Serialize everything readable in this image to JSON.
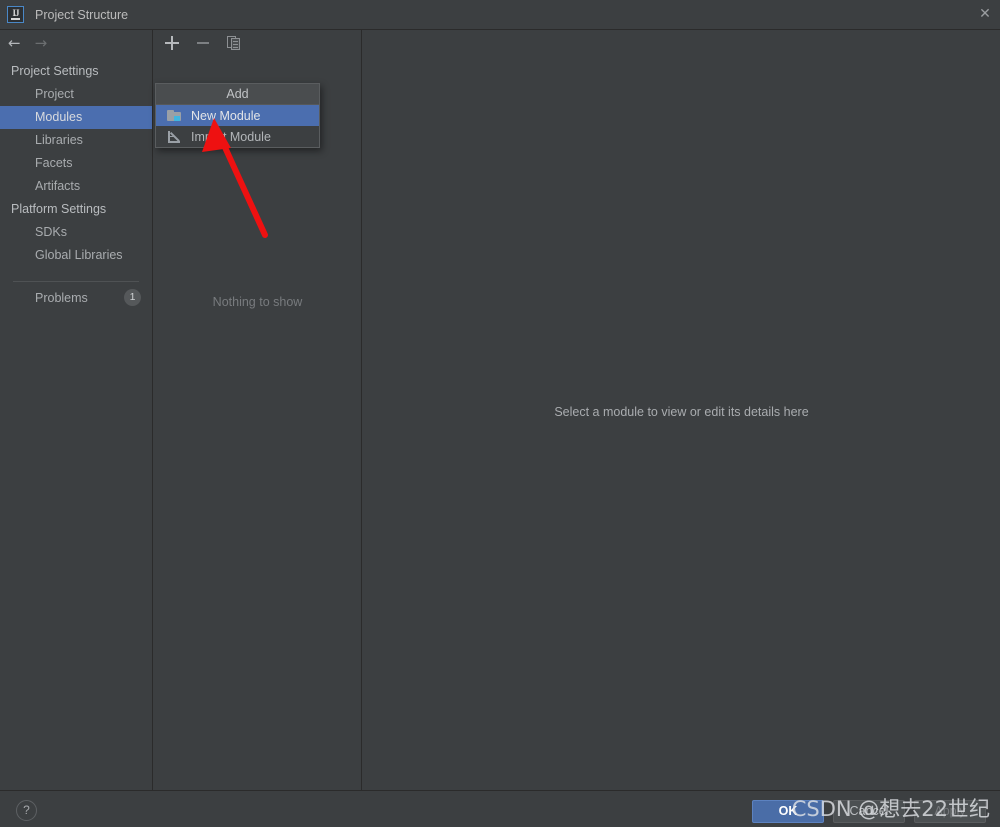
{
  "window": {
    "title": "Project Structure",
    "app_icon": "intellij-idea-logo-icon",
    "close_icon": "close-icon"
  },
  "sidebar": {
    "nav": {
      "back_icon": "arrow-left-icon",
      "forward_icon": "arrow-right-icon"
    },
    "groups": [
      {
        "label": "Project Settings",
        "items": [
          {
            "label": "Project",
            "selected": false
          },
          {
            "label": "Modules",
            "selected": true
          },
          {
            "label": "Libraries",
            "selected": false
          },
          {
            "label": "Facets",
            "selected": false
          },
          {
            "label": "Artifacts",
            "selected": false
          }
        ]
      },
      {
        "label": "Platform Settings",
        "items": [
          {
            "label": "SDKs",
            "selected": false
          },
          {
            "label": "Global Libraries",
            "selected": false
          }
        ]
      }
    ],
    "problems": {
      "label": "Problems",
      "count": "1"
    }
  },
  "middle_panel": {
    "toolbar": [
      {
        "name": "add-button",
        "icon": "plus-icon",
        "enabled": true
      },
      {
        "name": "remove-button",
        "icon": "minus-icon",
        "enabled": false
      },
      {
        "name": "copy-button",
        "icon": "copy-icon",
        "enabled": true
      }
    ],
    "empty_text": "Nothing to show"
  },
  "right_panel": {
    "empty_text": "Select a module to view or edit its details here"
  },
  "popup": {
    "header": "Add",
    "items": [
      {
        "label": "New Module",
        "icon": "folder-module-icon",
        "highlighted": true
      },
      {
        "label": "Import Module",
        "icon": "import-arrow-icon",
        "highlighted": false
      }
    ]
  },
  "annotation": {
    "type": "red-arrow",
    "color": "#ee1111",
    "points_to": "New Module"
  },
  "footer": {
    "help_label": "?",
    "buttons": [
      {
        "label": "OK",
        "style": "primary"
      },
      {
        "label": "Cancel",
        "style": "normal"
      },
      {
        "label": "Apply",
        "style": "disabled"
      }
    ]
  },
  "watermark": {
    "text": "CSDN @想去22世纪"
  },
  "colors": {
    "background": "#3c3f41",
    "selection": "#4b6eaf",
    "accent": "#4a6da7",
    "border": "#2b2b2b",
    "annotation": "#ee1111"
  }
}
